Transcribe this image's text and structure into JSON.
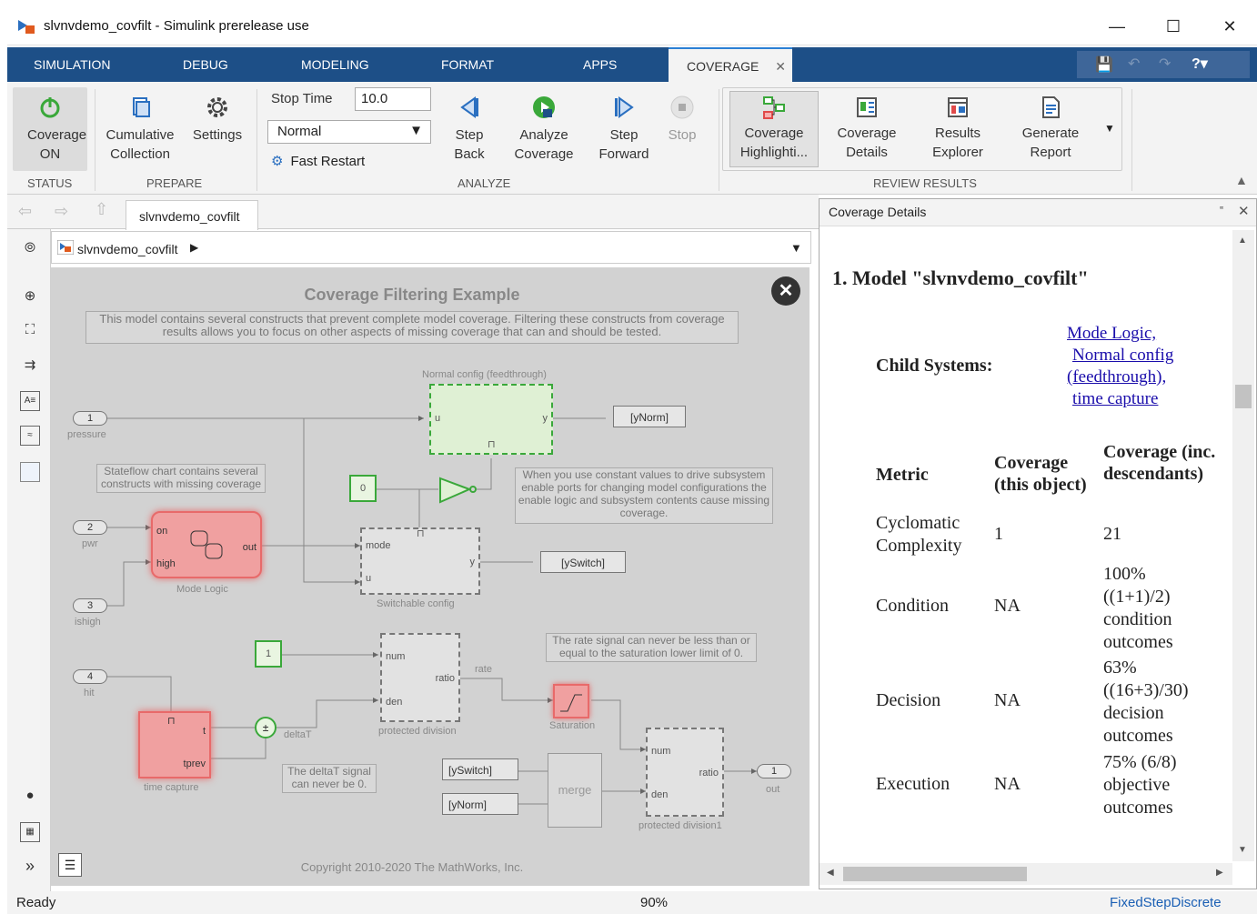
{
  "window": {
    "title": "slvnvdemo_covfilt - Simulink prerelease use"
  },
  "tabs": [
    {
      "label": "SIMULATION"
    },
    {
      "label": "DEBUG"
    },
    {
      "label": "MODELING"
    },
    {
      "label": "FORMAT"
    },
    {
      "label": "APPS"
    },
    {
      "label": "COVERAGE"
    }
  ],
  "toolstrip": {
    "status": {
      "button": "Coverage ON",
      "section": "STATUS"
    },
    "prepare": {
      "cumulative": "Cumulative Collection",
      "settings": "Settings",
      "section": "PREPARE"
    },
    "analyze": {
      "stop_time_label": "Stop Time",
      "stop_time_value": "10.0",
      "mode": "Normal",
      "fast_restart": "Fast Restart",
      "step_back": "Step Back",
      "analyze": "Analyze Coverage",
      "step_forward": "Step Forward",
      "stop": "Stop",
      "section": "ANALYZE"
    },
    "review": {
      "highlight": "Coverage Highlighti...",
      "details": "Coverage Details",
      "explorer": "Results Explorer",
      "report": "Generate Report",
      "section": "REVIEW RESULTS"
    }
  },
  "editor": {
    "tab": "slvnvdemo_covfilt",
    "breadcrumb": "slvnvdemo_covfilt"
  },
  "model": {
    "title": "Coverage Filtering Example",
    "description": "This model contains several constructs that prevent complete model coverage. Filtering these constructs from coverage results allows you to focus on other aspects of missing coverage that can and should be tested.",
    "normal_config": "Normal config (feedthrough)",
    "ynorm": "[yNorm]",
    "yswitch": "[ySwitch]",
    "in1": "1",
    "in1_label": "pressure",
    "in2": "2",
    "in2_label": "pwr",
    "in3": "3",
    "in3_label": "ishigh",
    "in4": "4",
    "in4_label": "hit",
    "stateflow_note": "Stateflow chart contains several constructs with missing coverage",
    "const0": "0",
    "const1": "1",
    "enable_note": "When you use constant values to drive subsystem enable ports for changing model configurations the enable logic and subsystem contents cause missing coverage.",
    "mode_logic": "Mode Logic",
    "switchable": "Switchable config",
    "rate_note": "The rate signal can never be less than or equal to the saturation lower limit of 0.",
    "protected_division": "protected division",
    "saturation": "Saturation",
    "rate": "rate",
    "deltat": "deltaT",
    "deltat_note": "The deltaT signal can never be 0.",
    "time_capture": "time capture",
    "merge": "merge",
    "protected_division1": "protected division1",
    "out1": "1",
    "out_label": "out",
    "copyright": "Copyright 2010-2020 The MathWorks, Inc.",
    "port_on": "on",
    "port_high": "high",
    "port_out": "out",
    "port_u": "u",
    "port_y": "y",
    "port_mode": "mode",
    "port_num": "num",
    "port_den": "den",
    "port_ratio": "ratio",
    "port_t": "t",
    "port_tprev": "tprev"
  },
  "panel": {
    "title": "Coverage Details",
    "heading": "1. Model \"slvnvdemo_covfilt\"",
    "child_systems_label": "Child Systems:",
    "child_links": [
      "Mode Logic,",
      "Normal config",
      "(feedthrough),",
      "time capture"
    ],
    "headers": [
      "Metric",
      "Coverage (this object)",
      "Coverage (inc. descendants)"
    ],
    "rows": [
      {
        "metric": "Cyclomatic Complexity",
        "this": "1",
        "inc": "21"
      },
      {
        "metric": "Condition",
        "this": "NA",
        "inc": "100% ((1+1)/2) condition outcomes"
      },
      {
        "metric": "Decision",
        "this": "NA",
        "inc": "63% ((16+3)/30) decision outcomes"
      },
      {
        "metric": "Execution",
        "this": "NA",
        "inc": "75% (6/8) objective outcomes"
      }
    ]
  },
  "status": {
    "left": "Ready",
    "zoom": "90%",
    "solver": "FixedStepDiscrete"
  },
  "colors": {
    "tabbar": "#1d4f87",
    "accent": "#2a7fd4",
    "red_block": "#f0a0a0",
    "green_block": "#dff0d4"
  }
}
